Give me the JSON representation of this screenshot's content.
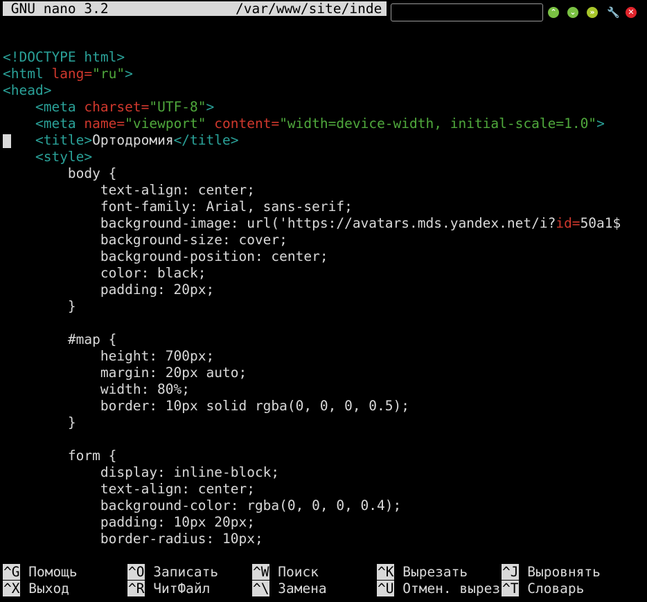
{
  "nano": {
    "version_label": " GNU nano 3.2",
    "file_path": "/var/www/site/inde"
  },
  "window_controls": [
    "chevron-up",
    "chevron-down",
    "chevron-double-down",
    "wrench",
    "close"
  ],
  "colors": {
    "tag": "#2aa198",
    "attribute": "#d0382d",
    "string": "#4fa83c",
    "text": "#d9d9d9",
    "background": "#000000"
  },
  "code_lines": [
    [
      {
        "t": "tag",
        "v": "<!DOCTYPE html>"
      }
    ],
    [
      {
        "t": "tag",
        "v": "<html "
      },
      {
        "t": "attr",
        "v": "lang="
      },
      {
        "t": "str",
        "v": "\"ru\""
      },
      {
        "t": "tag",
        "v": ">"
      }
    ],
    [
      {
        "t": "tag",
        "v": "<head>"
      }
    ],
    [
      {
        "t": "plain",
        "v": "    "
      },
      {
        "t": "tag",
        "v": "<meta "
      },
      {
        "t": "attr",
        "v": "charset="
      },
      {
        "t": "str",
        "v": "\"UTF-8\""
      },
      {
        "t": "tag",
        "v": ">"
      }
    ],
    [
      {
        "t": "plain",
        "v": "    "
      },
      {
        "t": "tag",
        "v": "<meta "
      },
      {
        "t": "attr",
        "v": "name="
      },
      {
        "t": "str",
        "v": "\"viewport\" "
      },
      {
        "t": "attr",
        "v": "content="
      },
      {
        "t": "str",
        "v": "\"width=device-width, initial-scale=1.0\""
      },
      {
        "t": "tag",
        "v": ">"
      }
    ],
    [
      {
        "t": "plain",
        "v": "    "
      },
      {
        "t": "tag",
        "v": "<title>"
      },
      {
        "t": "plain",
        "v": "Ортодромия"
      },
      {
        "t": "tag",
        "v": "</title>"
      }
    ],
    [
      {
        "t": "plain",
        "v": "    "
      },
      {
        "t": "tag",
        "v": "<style>"
      }
    ],
    [
      {
        "t": "plain",
        "v": "        body {"
      }
    ],
    [
      {
        "t": "plain",
        "v": "            text-align: center;"
      }
    ],
    [
      {
        "t": "plain",
        "v": "            font-family: Arial, sans-serif;"
      }
    ],
    [
      {
        "t": "plain",
        "v": "            background-image: url('https://avatars.mds.yandex.net/i?"
      },
      {
        "t": "attr",
        "v": "id="
      },
      {
        "t": "plain",
        "v": "50a1$"
      }
    ],
    [
      {
        "t": "plain",
        "v": "            background-size: cover;"
      }
    ],
    [
      {
        "t": "plain",
        "v": "            background-position: center;"
      }
    ],
    [
      {
        "t": "plain",
        "v": "            color: black;"
      }
    ],
    [
      {
        "t": "plain",
        "v": "            padding: 20px;"
      }
    ],
    [
      {
        "t": "plain",
        "v": "        }"
      }
    ],
    [
      {
        "t": "plain",
        "v": ""
      }
    ],
    [
      {
        "t": "plain",
        "v": "        #map {"
      }
    ],
    [
      {
        "t": "plain",
        "v": "            height: 700px;"
      }
    ],
    [
      {
        "t": "plain",
        "v": "            margin: 20px auto;"
      }
    ],
    [
      {
        "t": "plain",
        "v": "            width: 80%;"
      }
    ],
    [
      {
        "t": "plain",
        "v": "            border: 10px solid rgba(0, 0, 0, 0.5);"
      }
    ],
    [
      {
        "t": "plain",
        "v": "        }"
      }
    ],
    [
      {
        "t": "plain",
        "v": ""
      }
    ],
    [
      {
        "t": "plain",
        "v": "        form {"
      }
    ],
    [
      {
        "t": "plain",
        "v": "            display: inline-block;"
      }
    ],
    [
      {
        "t": "plain",
        "v": "            text-align: center;"
      }
    ],
    [
      {
        "t": "plain",
        "v": "            background-color: rgba(0, 0, 0, 0.4);"
      }
    ],
    [
      {
        "t": "plain",
        "v": "            padding: 10px 20px;"
      }
    ],
    [
      {
        "t": "plain",
        "v": "            border-radius: 10px;"
      }
    ]
  ],
  "shortcuts": [
    [
      {
        "key": "^G",
        "label": " Помощь"
      },
      {
        "key": "^O",
        "label": " Записать"
      },
      {
        "key": "^W",
        "label": " Поиск"
      },
      {
        "key": "^K",
        "label": " Вырезать"
      },
      {
        "key": "^J",
        "label": " Выровнять"
      }
    ],
    [
      {
        "key": "^X",
        "label": " Выход"
      },
      {
        "key": "^R",
        "label": " ЧитФайл"
      },
      {
        "key": "^\\",
        "label": " Замена"
      },
      {
        "key": "^U",
        "label": " Отмен. вырез"
      },
      {
        "key": "^T",
        "label": " Словарь"
      }
    ]
  ]
}
